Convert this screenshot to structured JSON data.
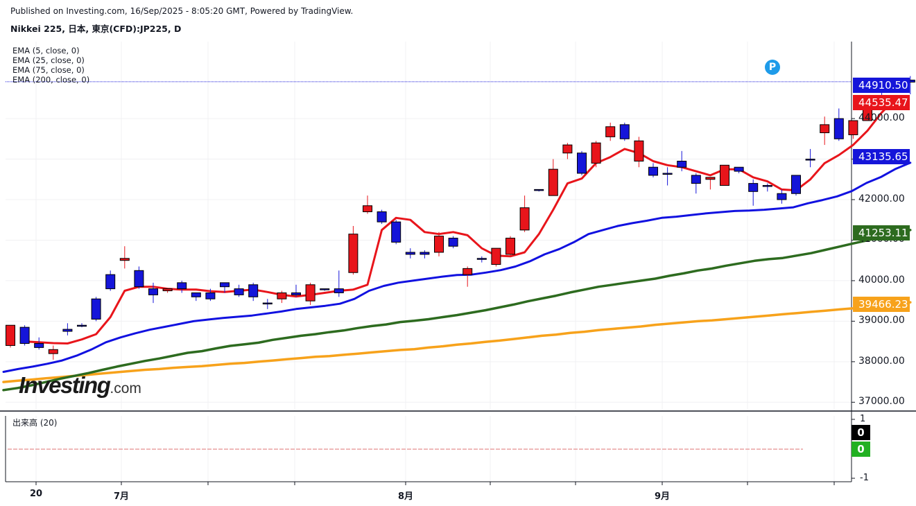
{
  "header": {
    "published": "Published on Investing.com, 16/Sep/2025 - 8:05:20 GMT, Powered by TradingView.",
    "symbol": "Nikkei 225, 日本, 東京(CFD):JP225, D"
  },
  "indicators": [
    {
      "label": "EMA (5, close, 0)",
      "color": "#e8151b"
    },
    {
      "label": "EMA (25, close, 0)",
      "color": "#1111e0"
    },
    {
      "label": "EMA (75, close, 0)",
      "color": "#2d6b1f"
    },
    {
      "label": "EMA (200, close, 0)",
      "color": "#f7a21b"
    }
  ],
  "price_labels": [
    {
      "text": "44910.50",
      "value": 44910.5,
      "color": "#1515d9"
    },
    {
      "text": "44535.47",
      "value": 44535.47,
      "color": "#e8151b"
    },
    {
      "text": "43135.65",
      "value": 43135.65,
      "color": "#1515d9"
    },
    {
      "text": "41253.11",
      "value": 41253.11,
      "color": "#2d6b1f"
    },
    {
      "text": "39466.23",
      "value": 39466.23,
      "color": "#f7a21b"
    }
  ],
  "volume": {
    "label": "出来高 (20)",
    "ticks": [
      "1",
      "-1"
    ],
    "boxes": [
      {
        "text": "0",
        "color": "#000000"
      },
      {
        "text": "0",
        "color": "#22b022"
      }
    ]
  },
  "logo": {
    "main": "Investing",
    "tld": ".com"
  },
  "badge": "P",
  "chart_data": {
    "type": "candlestick",
    "ylim": [
      36800,
      45900
    ],
    "y_ticks": [
      {
        "value": 37000,
        "label": "37000.00"
      },
      {
        "value": 38000,
        "label": "38000.00"
      },
      {
        "value": 39000,
        "label": "39000.00"
      },
      {
        "value": 40000,
        "label": "40000.00"
      },
      {
        "value": 41000,
        "label": "41000.00"
      },
      {
        "value": 42000,
        "label": "42000.00"
      },
      {
        "value": 43000,
        "label": "43000.00"
      },
      {
        "value": 44000,
        "label": "44000.00"
      }
    ],
    "x_ticks": [
      {
        "index": 2,
        "label": "20"
      },
      {
        "index": 8,
        "label": "7月"
      },
      {
        "index": 28,
        "label": "8月"
      },
      {
        "index": 46,
        "label": "9月"
      }
    ],
    "last_price": 44910.5,
    "up_color": "#1515d9",
    "down_color": "#e8151b",
    "candles": [
      {
        "o": 38900,
        "h": 38900,
        "l": 38350,
        "c": 38400
      },
      {
        "o": 38450,
        "h": 38900,
        "l": 38400,
        "c": 38850
      },
      {
        "o": 38350,
        "h": 38600,
        "l": 38300,
        "c": 38450
      },
      {
        "o": 38300,
        "h": 38400,
        "l": 38050,
        "c": 38200
      },
      {
        "o": 38750,
        "h": 38950,
        "l": 38650,
        "c": 38800
      },
      {
        "o": 38900,
        "h": 38950,
        "l": 38850,
        "c": 38900
      },
      {
        "o": 39050,
        "h": 39600,
        "l": 39000,
        "c": 39550
      },
      {
        "o": 39800,
        "h": 40250,
        "l": 39750,
        "c": 40150
      },
      {
        "o": 40550,
        "h": 40850,
        "l": 40300,
        "c": 40500
      },
      {
        "o": 39850,
        "h": 40350,
        "l": 39800,
        "c": 40250
      },
      {
        "o": 39650,
        "h": 39950,
        "l": 39450,
        "c": 39800
      },
      {
        "o": 39800,
        "h": 39800,
        "l": 39700,
        "c": 39750
      },
      {
        "o": 39800,
        "h": 40000,
        "l": 39700,
        "c": 39950
      },
      {
        "o": 39600,
        "h": 39700,
        "l": 39500,
        "c": 39700
      },
      {
        "o": 39550,
        "h": 39800,
        "l": 39500,
        "c": 39700
      },
      {
        "o": 39850,
        "h": 39950,
        "l": 39700,
        "c": 39950
      },
      {
        "o": 39650,
        "h": 39900,
        "l": 39600,
        "c": 39800
      },
      {
        "o": 39600,
        "h": 39950,
        "l": 39500,
        "c": 39900
      },
      {
        "o": 39450,
        "h": 39550,
        "l": 39300,
        "c": 39450
      },
      {
        "o": 39700,
        "h": 39750,
        "l": 39450,
        "c": 39550
      },
      {
        "o": 39650,
        "h": 39900,
        "l": 39600,
        "c": 39700
      },
      {
        "o": 39900,
        "h": 39950,
        "l": 39400,
        "c": 39500
      },
      {
        "o": 39800,
        "h": 39800,
        "l": 39750,
        "c": 39800
      },
      {
        "o": 39700,
        "h": 40250,
        "l": 39600,
        "c": 39800
      },
      {
        "o": 41150,
        "h": 41350,
        "l": 40150,
        "c": 40200
      },
      {
        "o": 41850,
        "h": 42100,
        "l": 41650,
        "c": 41700
      },
      {
        "o": 41450,
        "h": 41750,
        "l": 41400,
        "c": 41700
      },
      {
        "o": 40950,
        "h": 41500,
        "l": 40900,
        "c": 41450
      },
      {
        "o": 40650,
        "h": 40800,
        "l": 40550,
        "c": 40700
      },
      {
        "o": 40650,
        "h": 40750,
        "l": 40550,
        "c": 40700
      },
      {
        "o": 41100,
        "h": 41200,
        "l": 40600,
        "c": 40700
      },
      {
        "o": 40850,
        "h": 41100,
        "l": 40800,
        "c": 41050
      },
      {
        "o": 40300,
        "h": 40350,
        "l": 39850,
        "c": 40150
      },
      {
        "o": 40550,
        "h": 40600,
        "l": 40450,
        "c": 40550
      },
      {
        "o": 40800,
        "h": 40800,
        "l": 40350,
        "c": 40400
      },
      {
        "o": 41050,
        "h": 41100,
        "l": 40600,
        "c": 40650
      },
      {
        "o": 41800,
        "h": 42100,
        "l": 41200,
        "c": 41250
      },
      {
        "o": 42250,
        "h": 42250,
        "l": 42200,
        "c": 42250
      },
      {
        "o": 42750,
        "h": 43000,
        "l": 42100,
        "c": 42100
      },
      {
        "o": 43350,
        "h": 43400,
        "l": 43000,
        "c": 43150
      },
      {
        "o": 42650,
        "h": 43200,
        "l": 42600,
        "c": 43150
      },
      {
        "o": 43400,
        "h": 43450,
        "l": 42800,
        "c": 42900
      },
      {
        "o": 43800,
        "h": 43900,
        "l": 43450,
        "c": 43550
      },
      {
        "o": 43500,
        "h": 43900,
        "l": 43450,
        "c": 43850
      },
      {
        "o": 43450,
        "h": 43550,
        "l": 42800,
        "c": 42950
      },
      {
        "o": 42600,
        "h": 42900,
        "l": 42550,
        "c": 42800
      },
      {
        "o": 42650,
        "h": 42800,
        "l": 42350,
        "c": 42650
      },
      {
        "o": 42800,
        "h": 43200,
        "l": 42700,
        "c": 42950
      },
      {
        "o": 42400,
        "h": 42650,
        "l": 42150,
        "c": 42600
      },
      {
        "o": 42550,
        "h": 42550,
        "l": 42250,
        "c": 42500
      },
      {
        "o": 42850,
        "h": 42850,
        "l": 42350,
        "c": 42350
      },
      {
        "o": 42700,
        "h": 42800,
        "l": 42650,
        "c": 42800
      },
      {
        "o": 42200,
        "h": 42500,
        "l": 41850,
        "c": 42400
      },
      {
        "o": 42350,
        "h": 42400,
        "l": 42200,
        "c": 42350
      },
      {
        "o": 42000,
        "h": 42250,
        "l": 41900,
        "c": 42150
      },
      {
        "o": 42150,
        "h": 42600,
        "l": 42100,
        "c": 42600
      },
      {
        "o": 43000,
        "h": 43250,
        "l": 42800,
        "c": 43000
      },
      {
        "o": 43850,
        "h": 44050,
        "l": 43350,
        "c": 43650
      },
      {
        "o": 43500,
        "h": 44250,
        "l": 43450,
        "c": 44000
      },
      {
        "o": 43950,
        "h": 43950,
        "l": 43500,
        "c": 43600
      },
      {
        "o": 44450,
        "h": 44500,
        "l": 43950,
        "c": 43950
      },
      {
        "o": 44800,
        "h": 44950,
        "l": 44550,
        "c": 44800
      },
      {
        "o": 44900,
        "h": 44950,
        "l": 44850,
        "c": 44900
      },
      {
        "o": 44900,
        "h": 45050,
        "l": 44600,
        "c": 44950
      }
    ],
    "series": [
      {
        "name": "EMA (5, close, 0)",
        "color": "#e8151b",
        "values": [
          38500,
          38480,
          38460,
          38450,
          38550,
          38680,
          39100,
          39750,
          39850,
          39850,
          39800,
          39780,
          39780,
          39740,
          39720,
          39750,
          39780,
          39720,
          39650,
          39610,
          39650,
          39700,
          39750,
          39780,
          39900,
          41250,
          41550,
          41500,
          41200,
          41150,
          41200,
          41120,
          40800,
          40620,
          40600,
          40700,
          41150,
          41750,
          42400,
          42520,
          42900,
          43050,
          43250,
          43150,
          42950,
          42850,
          42800,
          42700,
          42600,
          42750,
          42750,
          42550,
          42450,
          42250,
          42230,
          42500,
          42900,
          43100,
          43350,
          43700,
          44150,
          44500
        ]
      },
      {
        "name": "EMA (25, close, 0)",
        "color": "#1111e0",
        "values": [
          37750,
          37820,
          37880,
          37950,
          38030,
          38150,
          38300,
          38480,
          38600,
          38700,
          38790,
          38860,
          38930,
          39000,
          39040,
          39080,
          39110,
          39140,
          39190,
          39240,
          39300,
          39340,
          39380,
          39430,
          39550,
          39750,
          39870,
          39950,
          40000,
          40050,
          40100,
          40140,
          40150,
          40200,
          40260,
          40350,
          40480,
          40650,
          40780,
          40950,
          41150,
          41250,
          41350,
          41420,
          41480,
          41550,
          41580,
          41620,
          41660,
          41690,
          41720,
          41730,
          41750,
          41780,
          41810,
          41910,
          41990,
          42080,
          42210,
          42410,
          42560,
          42760,
          42910
        ]
      },
      {
        "name": "EMA (75, close, 0)",
        "color": "#2d6b1f",
        "values": [
          37300,
          37350,
          37420,
          37500,
          37580,
          37650,
          37720,
          37800,
          37880,
          37950,
          38020,
          38080,
          38150,
          38220,
          38260,
          38330,
          38390,
          38430,
          38470,
          38540,
          38590,
          38640,
          38680,
          38730,
          38770,
          38830,
          38880,
          38920,
          38980,
          39010,
          39050,
          39100,
          39150,
          39210,
          39270,
          39340,
          39410,
          39490,
          39560,
          39630,
          39710,
          39780,
          39850,
          39900,
          39950,
          40000,
          40050,
          40120,
          40180,
          40250,
          40300,
          40370,
          40430,
          40490,
          40530,
          40560,
          40620,
          40680,
          40760,
          40840,
          40920,
          41000,
          41080,
          41150,
          41250
        ]
      },
      {
        "name": "EMA (200, close, 0)",
        "color": "#f7a21b",
        "values": [
          37500,
          37530,
          37560,
          37590,
          37620,
          37650,
          37680,
          37710,
          37740,
          37770,
          37800,
          37820,
          37850,
          37870,
          37890,
          37920,
          37950,
          37970,
          38000,
          38030,
          38060,
          38090,
          38120,
          38140,
          38170,
          38200,
          38230,
          38260,
          38290,
          38310,
          38350,
          38380,
          38420,
          38450,
          38490,
          38520,
          38560,
          38600,
          38640,
          38670,
          38710,
          38740,
          38780,
          38810,
          38840,
          38870,
          38910,
          38940,
          38970,
          39000,
          39020,
          39050,
          39080,
          39110,
          39140,
          39170,
          39200,
          39230,
          39260,
          39290,
          39320,
          39360,
          39400,
          39430,
          39466
        ]
      }
    ]
  }
}
